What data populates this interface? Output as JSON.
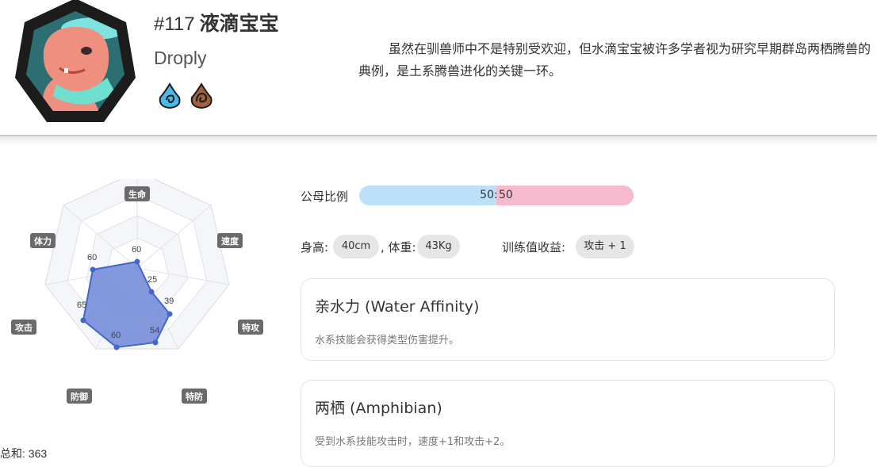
{
  "header": {
    "number": "#117",
    "name": "液滴宝宝",
    "en_name": "Droply",
    "types": [
      {
        "name": "water-type-icon",
        "color": "#4cb8e8"
      },
      {
        "name": "earth-type-icon",
        "color": "#a0623c"
      }
    ],
    "description": "虽然在驯兽师中不是特别受欢迎，但水滴宝宝被许多学者视为研究早期群岛两栖腾兽的典例，是土系腾兽进化的关键一环。"
  },
  "stats": {
    "labels": {
      "hp": "生命",
      "speed": "速度",
      "sp_atk": "特攻",
      "sp_def": "特防",
      "def": "防御",
      "atk": "攻击",
      "stamina": "体力"
    },
    "values": {
      "hp": "60",
      "speed": "25",
      "sp_atk": "39",
      "sp_def": "54",
      "def": "60",
      "atk": "65",
      "stamina": "60"
    },
    "total": "总和: 363",
    "fill_color": "#6f87d6",
    "point_color": "#4466cc"
  },
  "gender": {
    "label": "公母比例",
    "male": "50",
    "separator": ":",
    "female": "50",
    "male_color": "#bde0f9",
    "female_color": "#f6bace"
  },
  "info": {
    "height_label": "身高:",
    "height_value": "40cm",
    "weight_label": ", 体重:",
    "weight_value": "43Kg",
    "ev_label": "训练值收益:",
    "ev_value": "攻击 + 1"
  },
  "abilities": [
    {
      "title": "亲水力 (Water Affinity)",
      "desc": "水系技能会获得类型伤害提升。"
    },
    {
      "title": "两栖 (Amphibian)",
      "desc": "受到水系技能攻击时，速度+1和攻击+2。"
    }
  ]
}
